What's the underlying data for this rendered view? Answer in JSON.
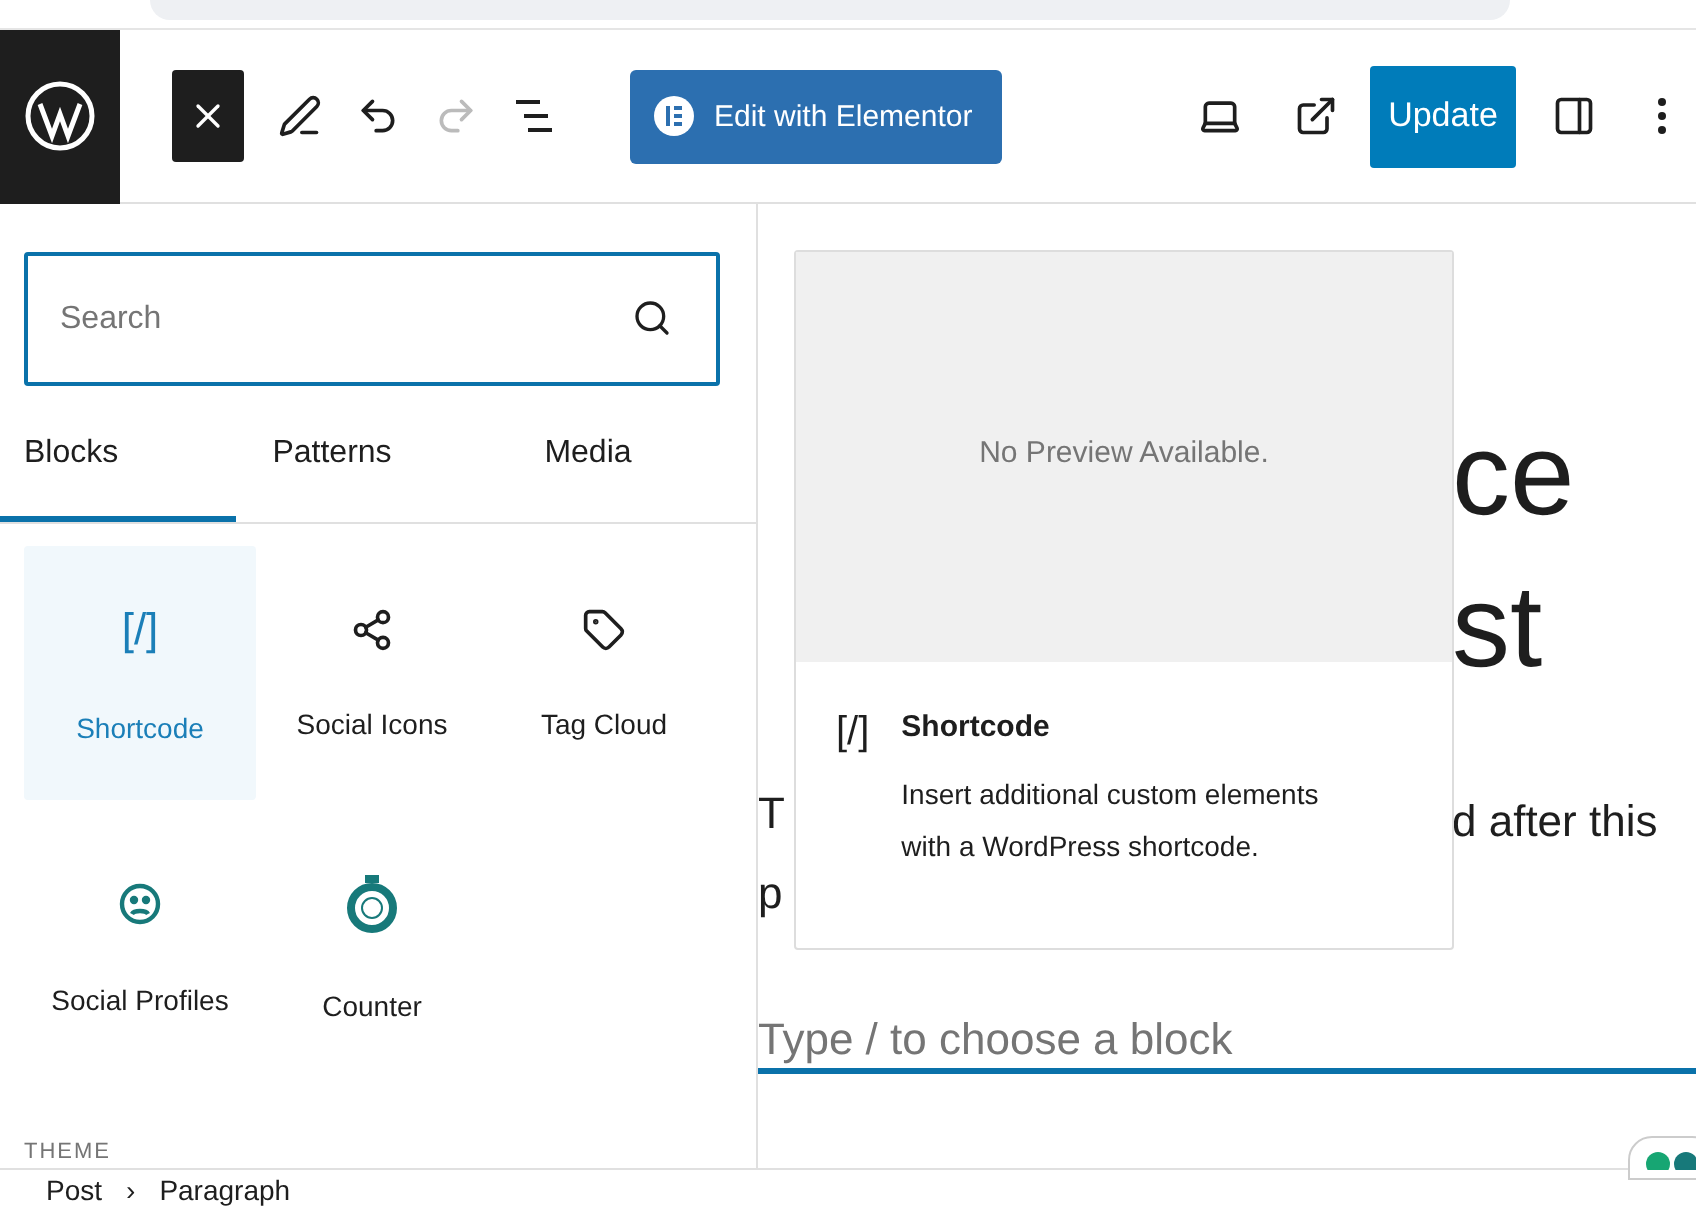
{
  "toolbar": {
    "elementor_button": "Edit with Elementor",
    "update_button": "Update",
    "redo_disabled": true
  },
  "inserter": {
    "search": {
      "placeholder": "Search"
    },
    "tabs": [
      {
        "label": "Blocks",
        "selected": true
      },
      {
        "label": "Patterns",
        "selected": false
      },
      {
        "label": "Media",
        "selected": false
      }
    ],
    "blocks": [
      {
        "kind": "shortcode",
        "glyph": "[/]",
        "label": "Shortcode",
        "selected": true
      },
      {
        "kind": "share",
        "label": "Social Icons",
        "selected": false
      },
      {
        "kind": "tag",
        "label": "Tag Cloud",
        "selected": false
      },
      {
        "kind": "profiles",
        "label": "Social Profiles",
        "selected": false
      },
      {
        "kind": "counter",
        "label": "Counter",
        "selected": false
      }
    ],
    "section_heading": "THEME"
  },
  "preview": {
    "message": "No Preview Available.",
    "glyph": "[/]",
    "title": "Shortcode",
    "description": "Insert additional custom elements with a WordPress shortcode."
  },
  "editor": {
    "heading_fragments": [
      "ce",
      "st"
    ],
    "paragraph_left_fragments": [
      "T",
      "p"
    ],
    "paragraph_right_fragment": "d after this",
    "appender": {
      "placeholder": "Type / to choose a block"
    }
  },
  "breadcrumb": {
    "items": [
      "Post",
      "Paragraph"
    ],
    "separator": "›"
  }
}
